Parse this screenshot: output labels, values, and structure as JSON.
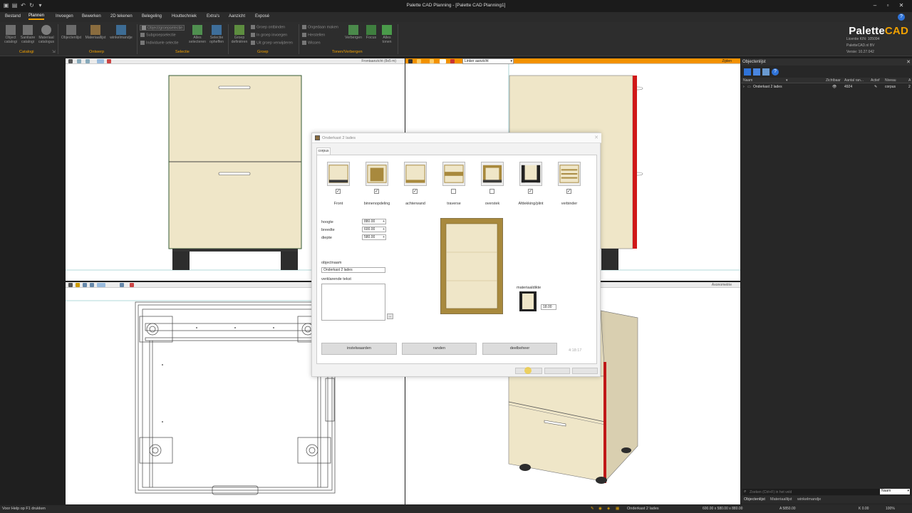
{
  "window": {
    "title": "Palette CAD Planning - [Palette CAD Planning1]",
    "min": "–",
    "max": "▫",
    "close": "✕"
  },
  "menu": {
    "items": [
      "Bestand",
      "Plannen",
      "Invoegen",
      "Bewerken",
      "2D tekenen",
      "Belegeling",
      "Houttechniek",
      "Extra's",
      "Aanzicht",
      "Exposé"
    ],
    "active": "Plannen"
  },
  "ribbon": {
    "buttons": {
      "object_catalog": "Object catalogi",
      "sanitaire": "Sanitaire catalogi",
      "materiaal": "Materiaal catalogus",
      "objectenlijst": "Objectenlijst",
      "materiaallijst": "Materiaallijst",
      "winkelmandje": "winkelmandje",
      "alles_selecteren": "Alles selecteren",
      "selectie_opheffen": "Selectie opheffen",
      "groep_definieren": "Groep definiëren",
      "verbergen": "Verbergen",
      "focus": "Focus",
      "alles_tonen": "Alles tonen"
    },
    "small": {
      "object_groepselectie": "Object/groepselectie",
      "subgroepselectie": "Subgroepselectie",
      "individuele_selectie": "Individuele selectie",
      "groep_ontbinden": "Groep ontbinden",
      "in_groep_invoegen": "In groep invoegen",
      "uit_groep_verwijderen": "Uit groep verwijderen",
      "ongedaan_maken": "Ongedaan maken",
      "herstellen": "Herstellen",
      "wissen": "Wissen"
    },
    "groups": {
      "catalogi": "Catalogi",
      "ontwerp": "Ontwerp",
      "selectie": "Selectie",
      "groep": "Groep",
      "tonen_verbergen": "Tonen/Verbergen"
    }
  },
  "brand": {
    "name_a": "Palette",
    "name_b": "CAD",
    "license": "Licentie KIN: 105094",
    "company": "PaletteCAD.nl BV",
    "version": "Versie: 10.27.042"
  },
  "viewports": {
    "front_label": "Frontaanzicht (8x5 m)",
    "side_label": "Zijden",
    "side_select": "Linker aanzicht",
    "iso_label": "Axonometrie"
  },
  "objpanel": {
    "title": "Objectenlijst",
    "columns": [
      "Naam",
      "Zichtbaar",
      "Aantal ran...",
      "Actief",
      "Niveau",
      "A"
    ],
    "row": {
      "name": "Onderkast 2 lades",
      "count": "4924",
      "level": "corpus",
      "extra": "2"
    },
    "search_placeholder": "Zoeken (Ctrl+F) in het veld",
    "search_scope": "Naam",
    "tabs": [
      "Objectenlijst",
      "Materiaallijst",
      "winkelmandje"
    ]
  },
  "dialog": {
    "title": "Onderkast 2 lades",
    "tab": "corpus",
    "parts": [
      {
        "label": "Front",
        "checked": true
      },
      {
        "label": "binnenopdeling",
        "checked": true
      },
      {
        "label": "achterwand",
        "checked": true
      },
      {
        "label": "traverse",
        "checked": false
      },
      {
        "label": "overstek",
        "checked": false
      },
      {
        "label": "Afdekking/plint",
        "checked": true
      },
      {
        "label": "verbinder",
        "checked": true
      }
    ],
    "fields": {
      "hoogte_label": "hoogte",
      "hoogte": "880.00",
      "breedte_label": "breedte",
      "breedte": "600.00",
      "diepte_label": "diepte",
      "diepte": "580.00"
    },
    "objectnaam_label": "objectnaam",
    "objectnaam": "Onderkast 2 lades",
    "verklarende_label": "verklarende tekst",
    "materiaaldikte_label": "materiaaldikte",
    "materiaaldikte": "18.00",
    "buttons": {
      "instelwaarden": "instelwaarden",
      "randen": "randen",
      "deelbeheer": "deelbeheer",
      "code": "4:18:17",
      "ellipsis": "..."
    }
  },
  "status": {
    "help": "Voor Help op F1 drukken",
    "object": "Onderkast 2 lades",
    "dims": "600.00 x 580.00 x 880.00",
    "a": "A 5850.00",
    "k": "K 0.00",
    "zoom": "100%"
  }
}
